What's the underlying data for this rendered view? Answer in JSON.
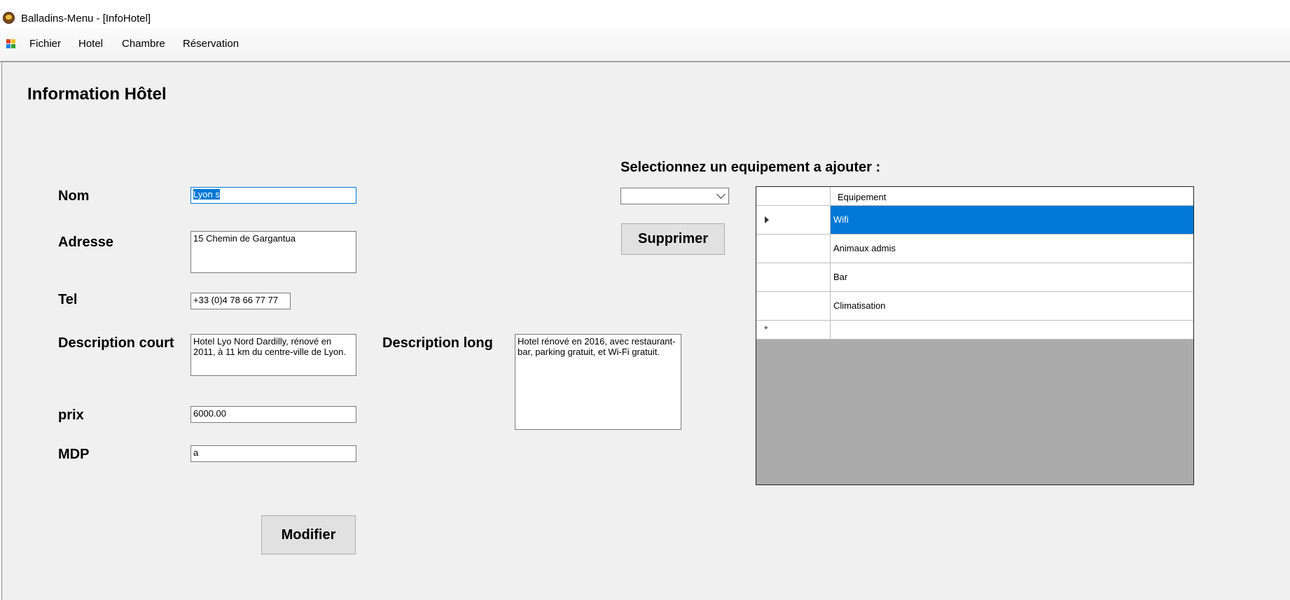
{
  "window": {
    "title": "Balladins-Menu - [InfoHotel]"
  },
  "menu": {
    "items": [
      "Fichier",
      "Hotel",
      "Chambre",
      "Réservation"
    ]
  },
  "form": {
    "title": "Information Hôtel",
    "nom": {
      "label": "Nom",
      "value": "Lyon s"
    },
    "adresse": {
      "label": "Adresse",
      "value": "15 Chemin de Gargantua"
    },
    "tel": {
      "label": "Tel",
      "value": "+33 (0)4 78 66 77 77"
    },
    "description_court": {
      "label": "Description court",
      "value": "Hotel Lyo Nord Dardilly, rénové en 2011, à 11 km du centre-ville de Lyon."
    },
    "description_long": {
      "label": "Description long",
      "value": "Hotel rénové en 2016, avec restaurant-bar, parking gratuit, et Wi-Fi gratuit."
    },
    "prix": {
      "label": "prix",
      "value": "6000.00"
    },
    "mdp": {
      "label": "MDP",
      "value": "a"
    },
    "modifier_label": "Modifier"
  },
  "equipements": {
    "prompt": "Selectionnez un equipement a ajouter :",
    "combo_value": "",
    "supprimer_label": "Supprimer",
    "column_header": "Equipement",
    "rows": [
      "Wifi",
      "Animaux admis",
      "Bar",
      "Climatisation"
    ],
    "selected_index": 0,
    "new_row_marker": "*"
  },
  "colors": {
    "selection": "#0078d7",
    "background": "#f0f0f0",
    "grid_empty": "#ababab"
  }
}
